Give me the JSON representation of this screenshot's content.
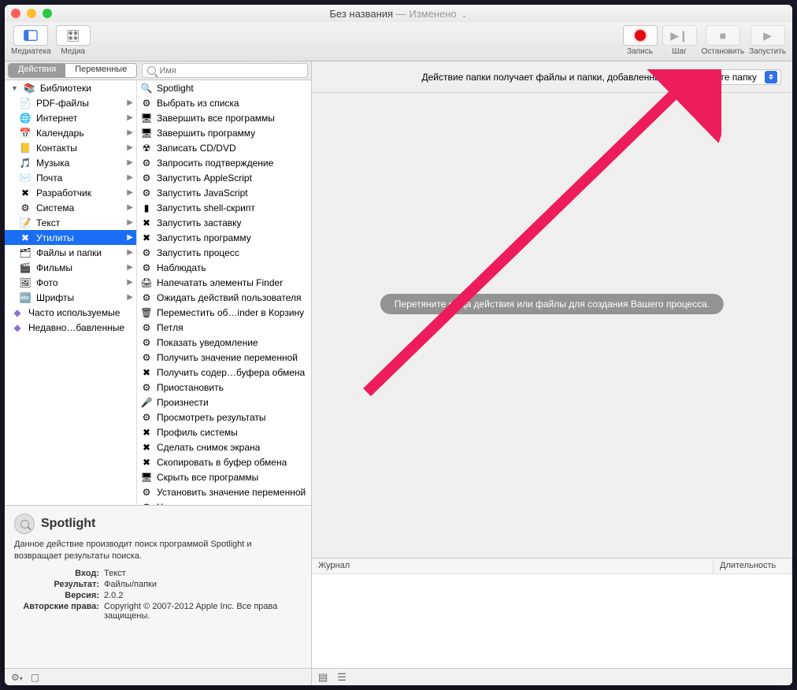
{
  "window": {
    "title": "Без названия",
    "subtitle": "— Изменено",
    "dropdown_glyph": "⌄"
  },
  "toolbar": {
    "library": "Медиатека",
    "media": "Медиа",
    "record": "Запись",
    "step": "Шаг",
    "stop": "Остановить",
    "run": "Запустить"
  },
  "segmented": {
    "actions": "Действия",
    "variables": "Переменные"
  },
  "search": {
    "placeholder": "Имя"
  },
  "library": {
    "root": "Библиотеки",
    "items": [
      {
        "label": "PDF-файлы",
        "glyph": "📄"
      },
      {
        "label": "Интернет",
        "glyph": "🌐"
      },
      {
        "label": "Календарь",
        "glyph": "📅"
      },
      {
        "label": "Контакты",
        "glyph": "📒"
      },
      {
        "label": "Музыка",
        "glyph": "🎵"
      },
      {
        "label": "Почта",
        "glyph": "✉️"
      },
      {
        "label": "Разработчик",
        "glyph": "✖︎"
      },
      {
        "label": "Система",
        "glyph": "⚙︎"
      },
      {
        "label": "Текст",
        "glyph": "📝"
      },
      {
        "label": "Утилиты",
        "glyph": "✖︎",
        "selected": true
      },
      {
        "label": "Файлы и папки",
        "glyph": "🗂"
      },
      {
        "label": "Фильмы",
        "glyph": "🎬"
      },
      {
        "label": "Фото",
        "glyph": "🖼"
      },
      {
        "label": "Шрифты",
        "glyph": "🔤"
      }
    ],
    "smart": [
      {
        "label": "Часто используемые"
      },
      {
        "label": "Недавно…бавленные"
      }
    ]
  },
  "actions": [
    {
      "label": "Spotlight",
      "glyph": "🔍"
    },
    {
      "label": "Выбрать из списка",
      "glyph": "⚙︎"
    },
    {
      "label": "Завершить все программы",
      "glyph": "🖥"
    },
    {
      "label": "Завершить программу",
      "glyph": "🖥"
    },
    {
      "label": "Записать CD/DVD",
      "glyph": "☢︎"
    },
    {
      "label": "Запросить подтверждение",
      "glyph": "⚙︎"
    },
    {
      "label": "Запустить AppleScript",
      "glyph": "⚙︎"
    },
    {
      "label": "Запустить JavaScript",
      "glyph": "⚙︎"
    },
    {
      "label": "Запустить shell-скрипт",
      "glyph": "▮"
    },
    {
      "label": "Запустить заставку",
      "glyph": "✖︎"
    },
    {
      "label": "Запустить программу",
      "glyph": "✖︎"
    },
    {
      "label": "Запустить процесс",
      "glyph": "⚙︎"
    },
    {
      "label": "Наблюдать",
      "glyph": "⚙︎"
    },
    {
      "label": "Напечатать элементы Finder",
      "glyph": "🖨"
    },
    {
      "label": "Ожидать действий пользователя",
      "glyph": "⚙︎"
    },
    {
      "label": "Переместить об…inder в Корзину",
      "glyph": "🗑"
    },
    {
      "label": "Петля",
      "glyph": "⚙︎"
    },
    {
      "label": "Показать уведомление",
      "glyph": "⚙︎"
    },
    {
      "label": "Получить значение переменной",
      "glyph": "⚙︎"
    },
    {
      "label": "Получить содер…буфера обмена",
      "glyph": "✖︎"
    },
    {
      "label": "Приостановить",
      "glyph": "⚙︎"
    },
    {
      "label": "Произнести",
      "glyph": "🎤"
    },
    {
      "label": "Просмотреть результаты",
      "glyph": "⚙︎"
    },
    {
      "label": "Профиль системы",
      "glyph": "✖︎"
    },
    {
      "label": "Сделать снимок экрана",
      "glyph": "✖︎"
    },
    {
      "label": "Скопировать в буфер обмена",
      "glyph": "✖︎"
    },
    {
      "label": "Скрыть все программы",
      "glyph": "🖥"
    },
    {
      "label": "Установить значение переменной",
      "glyph": "⚙︎"
    },
    {
      "label": "Установить уро…сти компьютера",
      "glyph": "⚙︎"
    }
  ],
  "info": {
    "title": "Spotlight",
    "desc": "Данное действие производит поиск программой Spotlight и возвращает результаты поиска.",
    "labels": {
      "input": "Вход:",
      "result": "Результат:",
      "version": "Версия:",
      "copyright": "Авторские права:"
    },
    "values": {
      "input": "Текст",
      "result": "Файлы/папки",
      "version": "2.0.2",
      "copyright": "Copyright © 2007-2012 Apple Inc. Все права защищены."
    }
  },
  "workflow": {
    "header_text": "Действие папки получает файлы и папки, добавленные в",
    "folder_select": "Выберите папку",
    "placeholder": "Перетяните сюда действия или файлы для создания Вашего процесса."
  },
  "log": {
    "col_journal": "Журнал",
    "col_duration": "Длительность"
  },
  "status": {
    "gear": "⚙︎",
    "view1": "≡",
    "view2": "☰"
  }
}
